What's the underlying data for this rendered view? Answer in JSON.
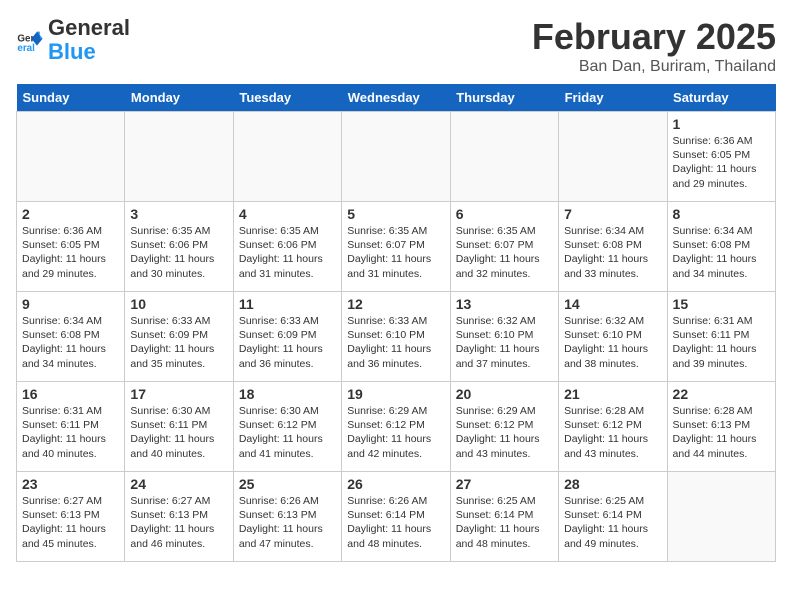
{
  "header": {
    "logo_general": "General",
    "logo_blue": "Blue",
    "month_title": "February 2025",
    "location": "Ban Dan, Buriram, Thailand"
  },
  "days_of_week": [
    "Sunday",
    "Monday",
    "Tuesday",
    "Wednesday",
    "Thursday",
    "Friday",
    "Saturday"
  ],
  "weeks": [
    [
      {
        "day": "",
        "info": ""
      },
      {
        "day": "",
        "info": ""
      },
      {
        "day": "",
        "info": ""
      },
      {
        "day": "",
        "info": ""
      },
      {
        "day": "",
        "info": ""
      },
      {
        "day": "",
        "info": ""
      },
      {
        "day": "1",
        "info": "Sunrise: 6:36 AM\nSunset: 6:05 PM\nDaylight: 11 hours\nand 29 minutes."
      }
    ],
    [
      {
        "day": "2",
        "info": "Sunrise: 6:36 AM\nSunset: 6:05 PM\nDaylight: 11 hours\nand 29 minutes."
      },
      {
        "day": "3",
        "info": "Sunrise: 6:35 AM\nSunset: 6:06 PM\nDaylight: 11 hours\nand 30 minutes."
      },
      {
        "day": "4",
        "info": "Sunrise: 6:35 AM\nSunset: 6:06 PM\nDaylight: 11 hours\nand 31 minutes."
      },
      {
        "day": "5",
        "info": "Sunrise: 6:35 AM\nSunset: 6:07 PM\nDaylight: 11 hours\nand 31 minutes."
      },
      {
        "day": "6",
        "info": "Sunrise: 6:35 AM\nSunset: 6:07 PM\nDaylight: 11 hours\nand 32 minutes."
      },
      {
        "day": "7",
        "info": "Sunrise: 6:34 AM\nSunset: 6:08 PM\nDaylight: 11 hours\nand 33 minutes."
      },
      {
        "day": "8",
        "info": "Sunrise: 6:34 AM\nSunset: 6:08 PM\nDaylight: 11 hours\nand 34 minutes."
      }
    ],
    [
      {
        "day": "9",
        "info": "Sunrise: 6:34 AM\nSunset: 6:08 PM\nDaylight: 11 hours\nand 34 minutes."
      },
      {
        "day": "10",
        "info": "Sunrise: 6:33 AM\nSunset: 6:09 PM\nDaylight: 11 hours\nand 35 minutes."
      },
      {
        "day": "11",
        "info": "Sunrise: 6:33 AM\nSunset: 6:09 PM\nDaylight: 11 hours\nand 36 minutes."
      },
      {
        "day": "12",
        "info": "Sunrise: 6:33 AM\nSunset: 6:10 PM\nDaylight: 11 hours\nand 36 minutes."
      },
      {
        "day": "13",
        "info": "Sunrise: 6:32 AM\nSunset: 6:10 PM\nDaylight: 11 hours\nand 37 minutes."
      },
      {
        "day": "14",
        "info": "Sunrise: 6:32 AM\nSunset: 6:10 PM\nDaylight: 11 hours\nand 38 minutes."
      },
      {
        "day": "15",
        "info": "Sunrise: 6:31 AM\nSunset: 6:11 PM\nDaylight: 11 hours\nand 39 minutes."
      }
    ],
    [
      {
        "day": "16",
        "info": "Sunrise: 6:31 AM\nSunset: 6:11 PM\nDaylight: 11 hours\nand 40 minutes."
      },
      {
        "day": "17",
        "info": "Sunrise: 6:30 AM\nSunset: 6:11 PM\nDaylight: 11 hours\nand 40 minutes."
      },
      {
        "day": "18",
        "info": "Sunrise: 6:30 AM\nSunset: 6:12 PM\nDaylight: 11 hours\nand 41 minutes."
      },
      {
        "day": "19",
        "info": "Sunrise: 6:29 AM\nSunset: 6:12 PM\nDaylight: 11 hours\nand 42 minutes."
      },
      {
        "day": "20",
        "info": "Sunrise: 6:29 AM\nSunset: 6:12 PM\nDaylight: 11 hours\nand 43 minutes."
      },
      {
        "day": "21",
        "info": "Sunrise: 6:28 AM\nSunset: 6:12 PM\nDaylight: 11 hours\nand 43 minutes."
      },
      {
        "day": "22",
        "info": "Sunrise: 6:28 AM\nSunset: 6:13 PM\nDaylight: 11 hours\nand 44 minutes."
      }
    ],
    [
      {
        "day": "23",
        "info": "Sunrise: 6:27 AM\nSunset: 6:13 PM\nDaylight: 11 hours\nand 45 minutes."
      },
      {
        "day": "24",
        "info": "Sunrise: 6:27 AM\nSunset: 6:13 PM\nDaylight: 11 hours\nand 46 minutes."
      },
      {
        "day": "25",
        "info": "Sunrise: 6:26 AM\nSunset: 6:13 PM\nDaylight: 11 hours\nand 47 minutes."
      },
      {
        "day": "26",
        "info": "Sunrise: 6:26 AM\nSunset: 6:14 PM\nDaylight: 11 hours\nand 48 minutes."
      },
      {
        "day": "27",
        "info": "Sunrise: 6:25 AM\nSunset: 6:14 PM\nDaylight: 11 hours\nand 48 minutes."
      },
      {
        "day": "28",
        "info": "Sunrise: 6:25 AM\nSunset: 6:14 PM\nDaylight: 11 hours\nand 49 minutes."
      },
      {
        "day": "",
        "info": ""
      }
    ]
  ]
}
